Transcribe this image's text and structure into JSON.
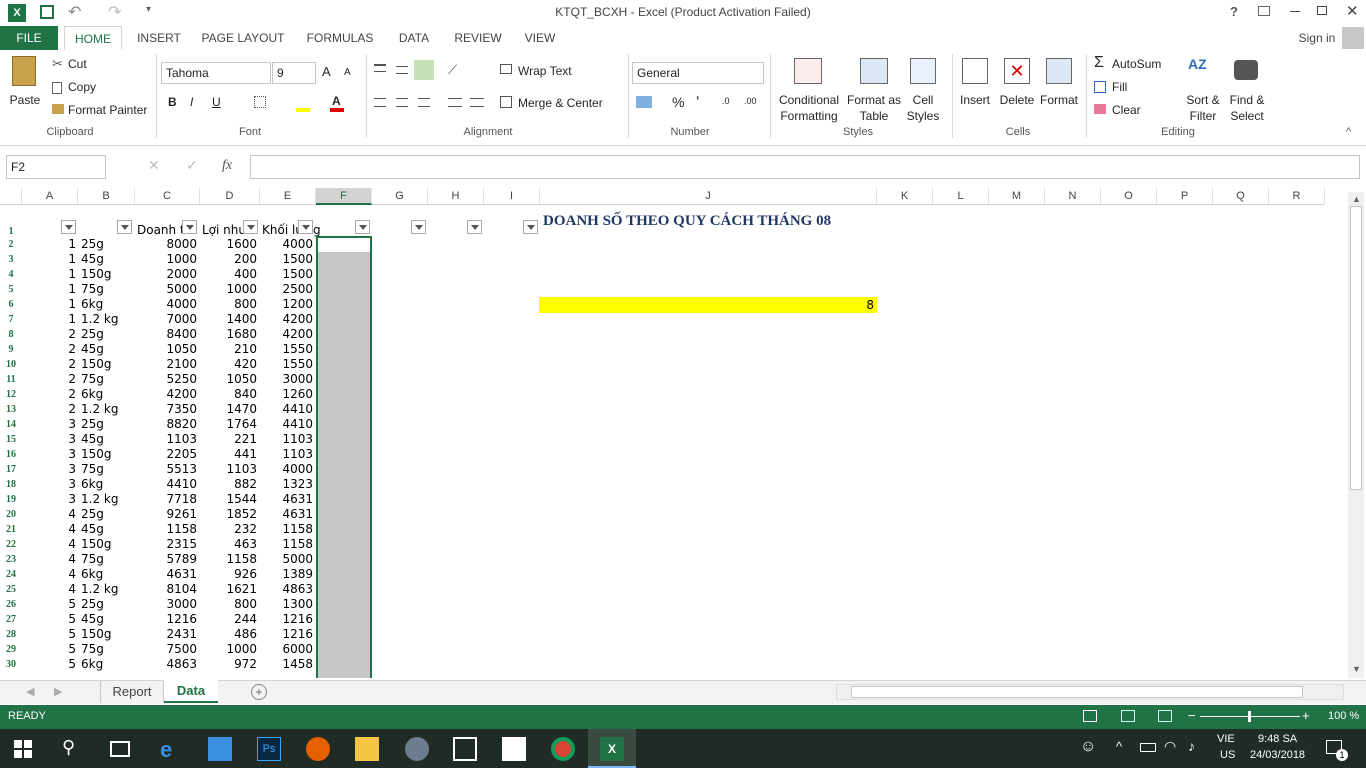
{
  "window": {
    "title": "KTQT_BCXH - Excel (Product Activation Failed)",
    "signin": "Sign in",
    "help": "?"
  },
  "tabs": [
    "FILE",
    "HOME",
    "INSERT",
    "PAGE LAYOUT",
    "FORMULAS",
    "DATA",
    "REVIEW",
    "VIEW"
  ],
  "clipboard": {
    "paste": "Paste",
    "cut": "Cut",
    "copy": "Copy",
    "format_painter": "Format Painter",
    "label": "Clipboard"
  },
  "font": {
    "name": "Tahoma",
    "size": "9",
    "label": "Font",
    "bold": "B",
    "italic": "I",
    "underline": "U"
  },
  "alignment": {
    "wrap": "Wrap Text",
    "merge": "Merge & Center",
    "label": "Alignment"
  },
  "number": {
    "format": "General",
    "label": "Number",
    "percent": "%",
    "comma": "’"
  },
  "styles": {
    "conditional": "Conditional",
    "conditional2": "Formatting",
    "format_as": "Format as",
    "table": "Table",
    "cell": "Cell",
    "styles_word": "Styles",
    "label": "Styles"
  },
  "cells": {
    "insert": "Insert",
    "delete": "Delete",
    "format": "Format",
    "label": "Cells"
  },
  "editing": {
    "autosum": "AutoSum",
    "fill": "Fill",
    "clear": "Clear",
    "sort": "Sort &",
    "filter": "Filter",
    "find": "Find &",
    "select": "Select",
    "label": "Editing"
  },
  "formula_bar": {
    "name_box": "F2",
    "fx": "fx",
    "value": ""
  },
  "columns": [
    "A",
    "B",
    "C",
    "D",
    "E",
    "F",
    "G",
    "H",
    "I",
    "J",
    "K",
    "L",
    "M",
    "N",
    "O",
    "P",
    "Q",
    "R"
  ],
  "headers_row1": {
    "c": "Doanh t",
    "d": "Lợi nhu",
    "e": "Khối lư",
    "e_tail": "g"
  },
  "report_title": "DOANH SỐ THEO QUY CÁCH THÁNG 08",
  "highlight_value": "8",
  "rows": [
    {
      "r": "2",
      "a": "1",
      "b": "25g",
      "c": "8000",
      "d": "1600",
      "e": "4000"
    },
    {
      "r": "3",
      "a": "1",
      "b": "45g",
      "c": "1000",
      "d": "200",
      "e": "1500"
    },
    {
      "r": "4",
      "a": "1",
      "b": "150g",
      "c": "2000",
      "d": "400",
      "e": "1500"
    },
    {
      "r": "5",
      "a": "1",
      "b": "75g",
      "c": "5000",
      "d": "1000",
      "e": "2500"
    },
    {
      "r": "6",
      "a": "1",
      "b": "6kg",
      "c": "4000",
      "d": "800",
      "e": "1200"
    },
    {
      "r": "7",
      "a": "1",
      "b": "1.2 kg",
      "c": "7000",
      "d": "1400",
      "e": "4200"
    },
    {
      "r": "8",
      "a": "2",
      "b": "25g",
      "c": "8400",
      "d": "1680",
      "e": "4200"
    },
    {
      "r": "9",
      "a": "2",
      "b": "45g",
      "c": "1050",
      "d": "210",
      "e": "1550"
    },
    {
      "r": "10",
      "a": "2",
      "b": "150g",
      "c": "2100",
      "d": "420",
      "e": "1550"
    },
    {
      "r": "11",
      "a": "2",
      "b": "75g",
      "c": "5250",
      "d": "1050",
      "e": "3000"
    },
    {
      "r": "12",
      "a": "2",
      "b": "6kg",
      "c": "4200",
      "d": "840",
      "e": "1260"
    },
    {
      "r": "13",
      "a": "2",
      "b": "1.2 kg",
      "c": "7350",
      "d": "1470",
      "e": "4410"
    },
    {
      "r": "14",
      "a": "3",
      "b": "25g",
      "c": "8820",
      "d": "1764",
      "e": "4410"
    },
    {
      "r": "15",
      "a": "3",
      "b": "45g",
      "c": "1103",
      "d": "221",
      "e": "1103"
    },
    {
      "r": "16",
      "a": "3",
      "b": "150g",
      "c": "2205",
      "d": "441",
      "e": "1103"
    },
    {
      "r": "17",
      "a": "3",
      "b": "75g",
      "c": "5513",
      "d": "1103",
      "e": "4000"
    },
    {
      "r": "18",
      "a": "3",
      "b": "6kg",
      "c": "4410",
      "d": "882",
      "e": "1323"
    },
    {
      "r": "19",
      "a": "3",
      "b": "1.2 kg",
      "c": "7718",
      "d": "1544",
      "e": "4631"
    },
    {
      "r": "20",
      "a": "4",
      "b": "25g",
      "c": "9261",
      "d": "1852",
      "e": "4631"
    },
    {
      "r": "21",
      "a": "4",
      "b": "45g",
      "c": "1158",
      "d": "232",
      "e": "1158"
    },
    {
      "r": "22",
      "a": "4",
      "b": "150g",
      "c": "2315",
      "d": "463",
      "e": "1158"
    },
    {
      "r": "23",
      "a": "4",
      "b": "75g",
      "c": "5789",
      "d": "1158",
      "e": "5000"
    },
    {
      "r": "24",
      "a": "4",
      "b": "6kg",
      "c": "4631",
      "d": "926",
      "e": "1389"
    },
    {
      "r": "25",
      "a": "4",
      "b": "1.2 kg",
      "c": "8104",
      "d": "1621",
      "e": "4863"
    },
    {
      "r": "26",
      "a": "5",
      "b": "25g",
      "c": "3000",
      "d": "800",
      "e": "1300"
    },
    {
      "r": "27",
      "a": "5",
      "b": "45g",
      "c": "1216",
      "d": "244",
      "e": "1216"
    },
    {
      "r": "28",
      "a": "5",
      "b": "150g",
      "c": "2431",
      "d": "486",
      "e": "1216"
    },
    {
      "r": "29",
      "a": "5",
      "b": "75g",
      "c": "7500",
      "d": "1000",
      "e": "6000"
    },
    {
      "r": "30",
      "a": "5",
      "b": "6kg",
      "c": "4863",
      "d": "972",
      "e": "1458"
    }
  ],
  "sheet_tabs": [
    "Report",
    "Data"
  ],
  "status": {
    "ready": "READY",
    "zoom": "100 %"
  },
  "taskbar": {
    "lang1": "VIE",
    "lang2": "US",
    "time": "9:48 SA",
    "date": "24/03/2018",
    "notif": "1"
  },
  "colors": {
    "excel_green": "#217346",
    "highlight": "#ffff00",
    "title_blue": "#1f3864"
  }
}
